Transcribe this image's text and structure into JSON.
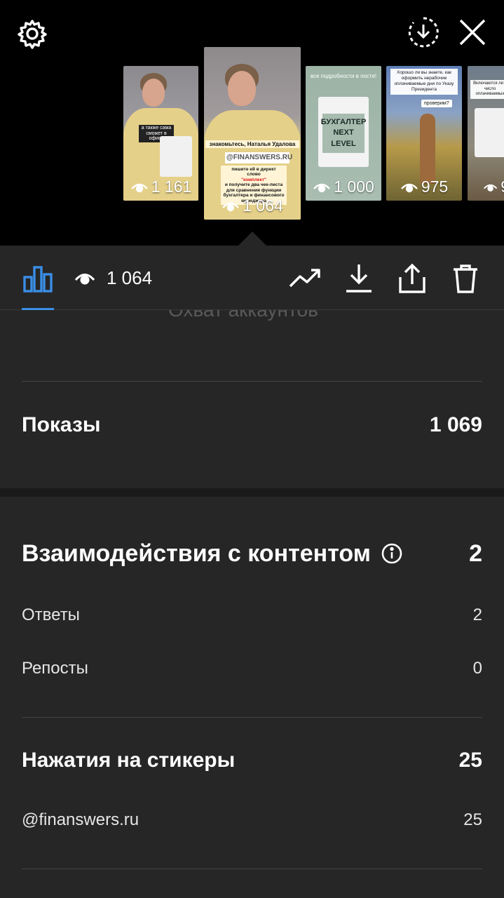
{
  "stories": [
    {
      "views": "1 161",
      "caption": "а также сама сможет в офисе"
    },
    {
      "views": "1 064",
      "caption_name": "знакомьтесь, Наталья Удалова",
      "handle": "@FINANSWERS.RU",
      "caption_lines": [
        "пишите ей в директ",
        "слово",
        "\"комплект\"",
        "и получите два чек-листа",
        "для сравнения функции",
        "бухгалтера и финансового",
        "менеджера"
      ]
    },
    {
      "views": "1 000",
      "title": "все подробности в посте!",
      "card_text": "БУХГАЛТЕР NEXT LEVEL"
    },
    {
      "views": "975",
      "caption": "Хорошо ли вы знаете, как оформить нерабочие оплачиваемые дни по Указу Президента",
      "badge": "проверим?"
    },
    {
      "views": "9",
      "caption": "Включаются ли в число оплачиваемых"
    }
  ],
  "toolbar": {
    "views": "1 064",
    "icons": [
      "bar-chart-icon",
      "eye-icon",
      "trend-icon",
      "download-icon",
      "share-icon",
      "trash-icon"
    ]
  },
  "ghost_heading": "Охват аккаунтов",
  "impressions": {
    "label": "Показы",
    "value": "1 069"
  },
  "interactions": {
    "label": "Взаимодействия с контентом",
    "value": "2",
    "rows": [
      {
        "label": "Ответы",
        "value": "2"
      },
      {
        "label": "Репосты",
        "value": "0"
      }
    ]
  },
  "sticker_taps": {
    "label": "Нажатия на стикеры",
    "value": "25",
    "rows": [
      {
        "label": "@finanswers.ru",
        "value": "25"
      }
    ]
  },
  "colors": {
    "accent": "#3a8ee6",
    "panel": "#262626",
    "background": "#000000"
  }
}
